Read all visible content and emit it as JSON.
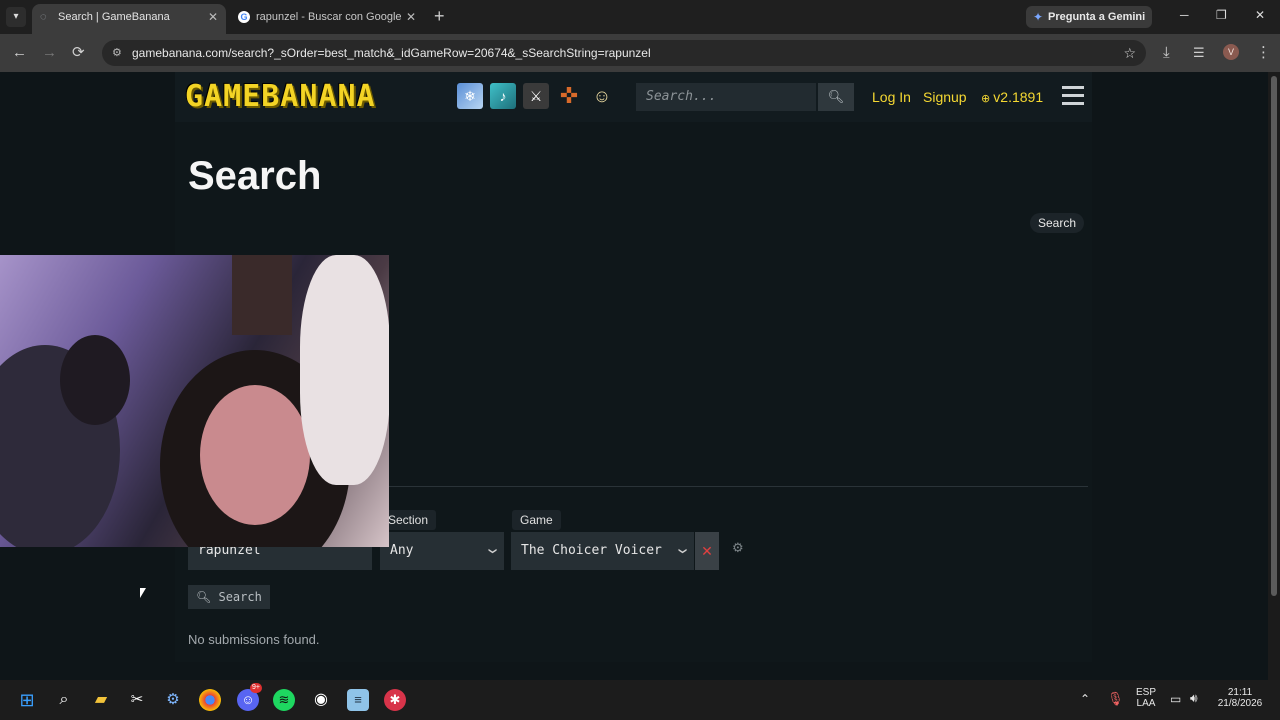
{
  "browser": {
    "tabs": [
      {
        "title": "Search | GameBanana",
        "active": true
      },
      {
        "title": "rapunzel - Buscar con Google",
        "active": false
      }
    ],
    "gemini_label": "Pregunta a Gemini",
    "url": "gamebanana.com/search?_sOrder=best_match&_idGameRow=20674&_sSearchString=rapunzel",
    "profile_initial": "V"
  },
  "site": {
    "logo_text": "GAMEBANANA",
    "search_placeholder": "Search...",
    "login": "Log In",
    "signup": "Signup",
    "version": "v2.1891"
  },
  "page": {
    "title": "Search",
    "search_tag": "Search",
    "section_label": "Section",
    "game_label": "Game",
    "query_value": "rapunzel",
    "section_value": "Any",
    "game_value": "The Choicer Voicer",
    "submit_label": "Search",
    "empty_message": "No submissions found."
  },
  "taskbar": {
    "lang_top": "ESP",
    "lang_bottom": "LAA",
    "time": "21:11",
    "date": "21/8/2026",
    "discord_badge": "9+"
  },
  "colors": {
    "accent_yellow": "#f5d832",
    "page_bg": "#0e1518",
    "clear_red": "#e04040"
  }
}
